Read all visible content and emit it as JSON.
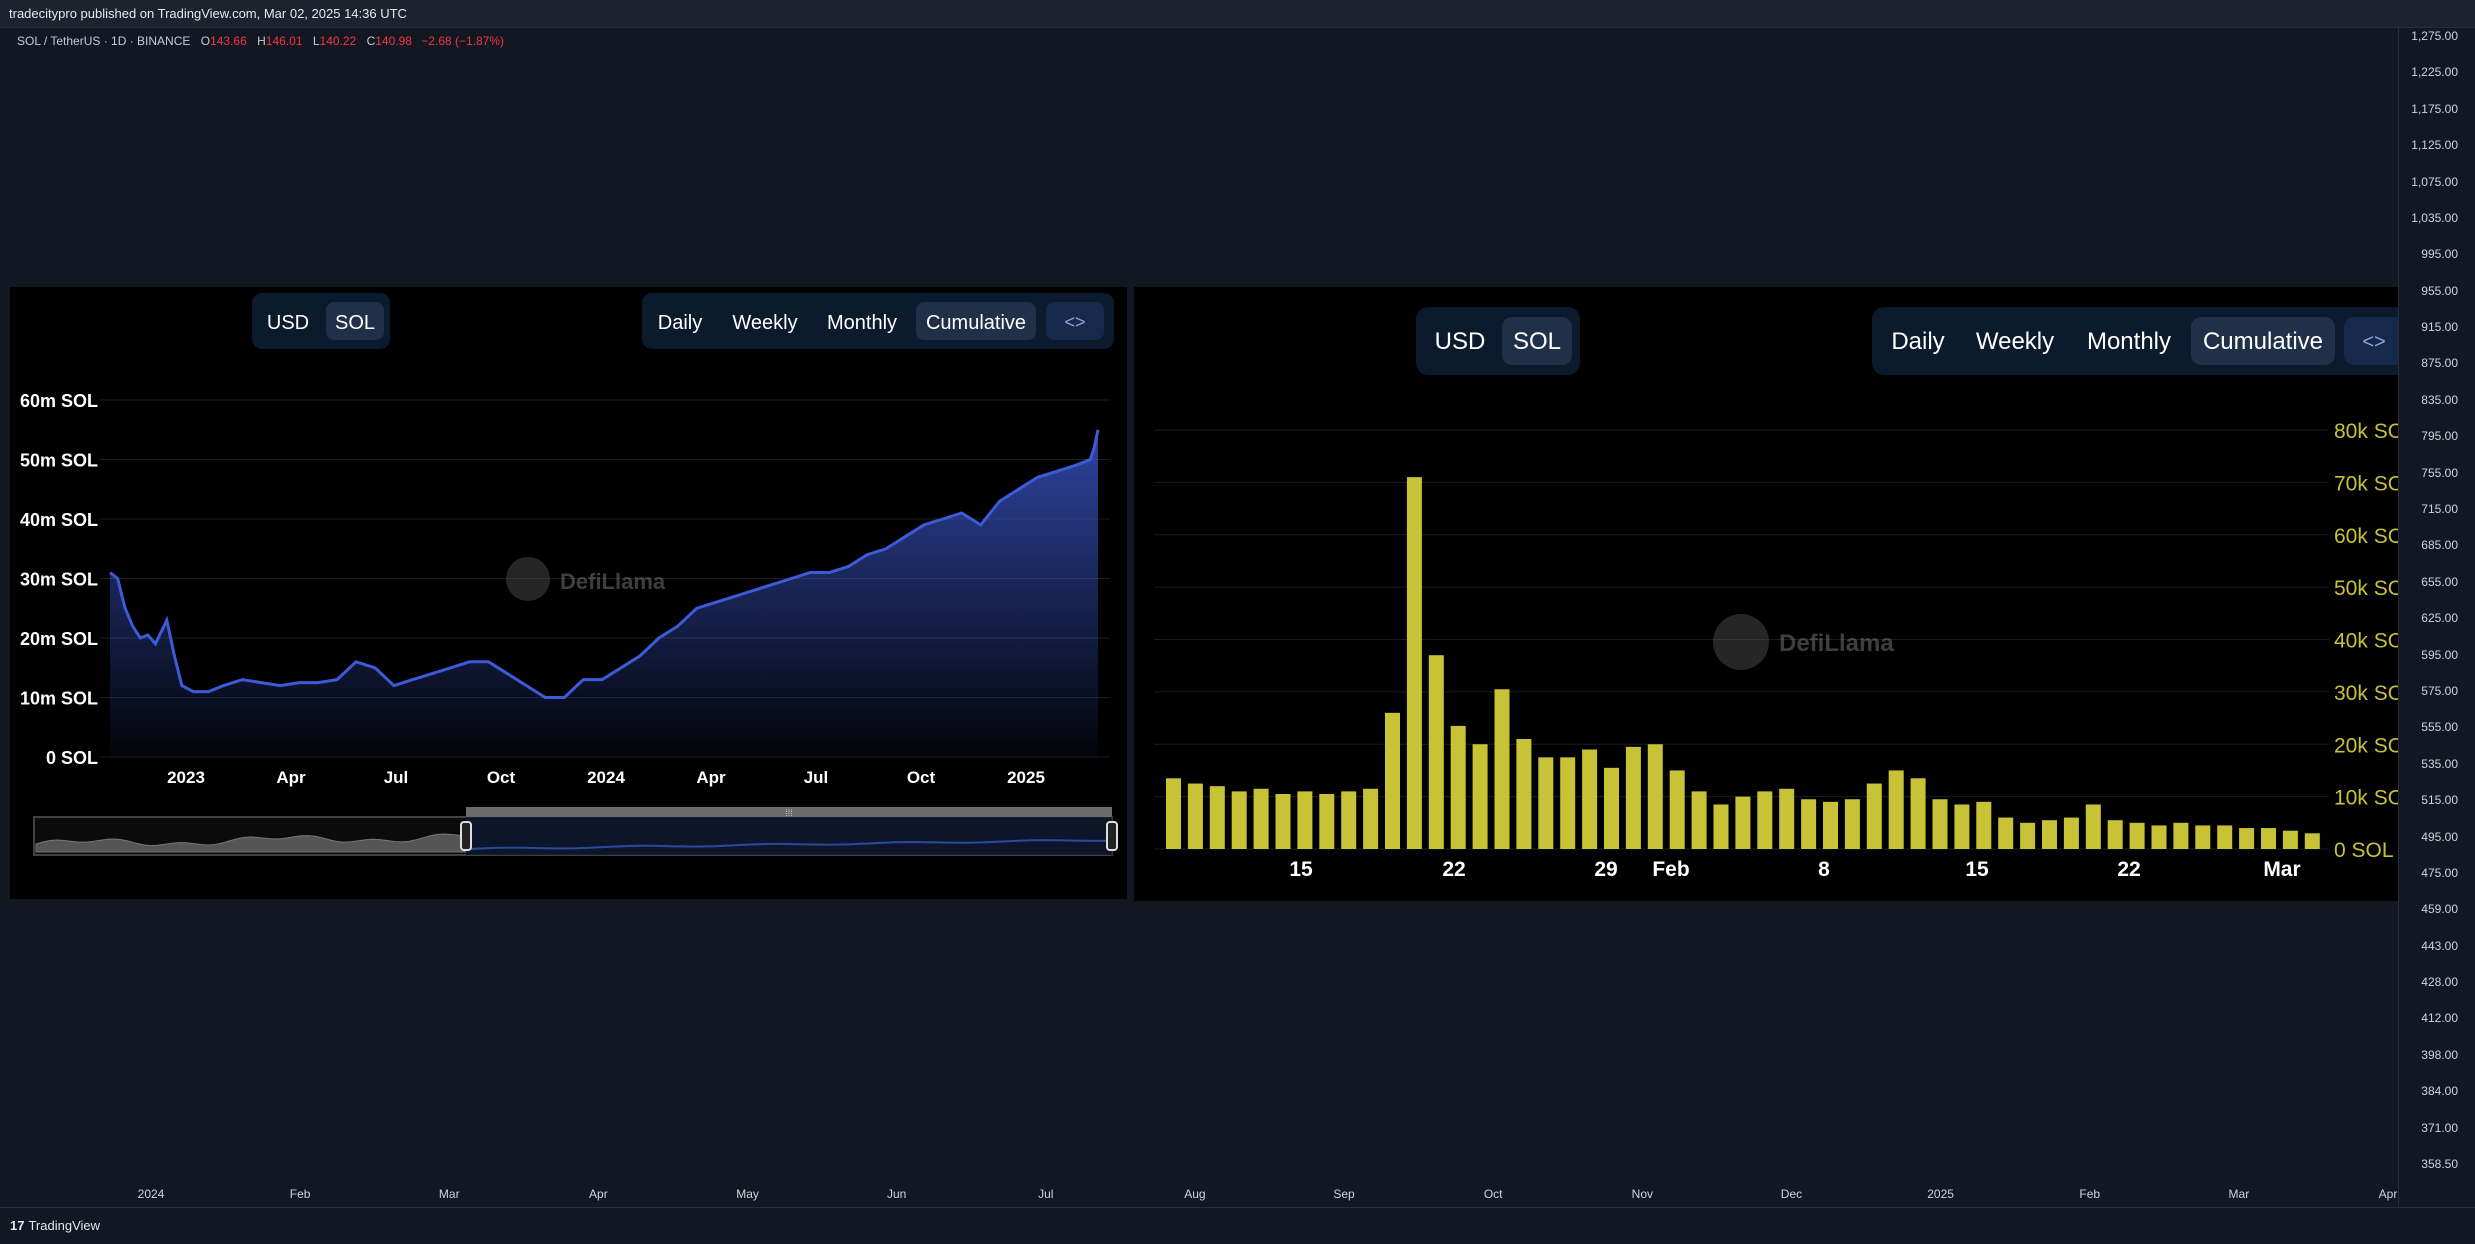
{
  "header": {
    "published": "tradecitypro published on TradingView.com, Mar 02, 2025 14:36 UTC"
  },
  "legend": {
    "symbol": "SOL / TetherUS · 1D · BINANCE",
    "open_label": "O",
    "open": "143.66",
    "high_label": "H",
    "high": "146.01",
    "low_label": "L",
    "low": "140.22",
    "close_label": "C",
    "close": "140.98",
    "change": "−2.68 (−1.87%)",
    "change_color": "#f23645"
  },
  "price_axis": [
    "1,275.00",
    "1,225.00",
    "1,175.00",
    "1,125.00",
    "1,075.00",
    "1,035.00",
    "995.00",
    "955.00",
    "915.00",
    "875.00",
    "835.00",
    "795.00",
    "755.00",
    "715.00",
    "685.00",
    "655.00",
    "625.00",
    "595.00",
    "575.00",
    "555.00",
    "535.00",
    "515.00",
    "495.00",
    "475.00",
    "459.00",
    "443.00",
    "428.00",
    "412.00",
    "398.00",
    "384.00",
    "371.00",
    "358.50"
  ],
  "time_axis": [
    "2024",
    "Feb",
    "Mar",
    "Apr",
    "May",
    "Jun",
    "Jul",
    "Aug",
    "Sep",
    "Oct",
    "Nov",
    "Dec",
    "2025",
    "Feb",
    "Mar",
    "Apr"
  ],
  "footer": {
    "brand": "TradingView",
    "brand_mark": "17"
  },
  "panels": {
    "left": {
      "currency_tabs": [
        "USD",
        "SOL"
      ],
      "active_currency": "SOL",
      "period_tabs": [
        "Daily",
        "Weekly",
        "Monthly",
        "Cumulative"
      ],
      "active_period": "Cumulative",
      "embed_icon": "<>",
      "watermark": "DefiLlama"
    },
    "right": {
      "currency_tabs": [
        "USD",
        "SOL"
      ],
      "active_currency": "SOL",
      "period_tabs": [
        "Daily",
        "Weekly",
        "Monthly",
        "Cumulative"
      ],
      "active_period": "Cumulative",
      "embed_icon": "<>",
      "watermark": "DefiLlama"
    }
  },
  "chart_data": [
    {
      "type": "area",
      "color": "#3d5bd6",
      "x_ticks": [
        "2023",
        "Apr",
        "Jul",
        "Oct",
        "2024",
        "Apr",
        "Jul",
        "Oct",
        "2025"
      ],
      "y_ticks": [
        "0 SOL",
        "10m SOL",
        "20m SOL",
        "30m SOL",
        "40m SOL",
        "50m SOL",
        "60m SOL"
      ],
      "ylim": [
        0,
        60
      ],
      "y_unit": "m SOL",
      "points": [
        [
          0,
          31
        ],
        [
          0.2,
          30
        ],
        [
          0.4,
          25
        ],
        [
          0.6,
          22
        ],
        [
          0.8,
          20
        ],
        [
          1.0,
          20.5
        ],
        [
          1.2,
          19
        ],
        [
          1.5,
          23
        ],
        [
          1.7,
          17
        ],
        [
          1.9,
          12
        ],
        [
          2.2,
          11
        ],
        [
          2.6,
          11
        ],
        [
          3.0,
          12
        ],
        [
          3.5,
          13
        ],
        [
          4.0,
          12.5
        ],
        [
          4.5,
          12
        ],
        [
          5.0,
          12.5
        ],
        [
          5.5,
          12.5
        ],
        [
          6.0,
          13
        ],
        [
          6.5,
          16
        ],
        [
          7.0,
          15
        ],
        [
          7.5,
          12
        ],
        [
          8.0,
          13
        ],
        [
          8.5,
          14
        ],
        [
          9.0,
          15
        ],
        [
          9.5,
          16
        ],
        [
          10.0,
          16
        ],
        [
          10.5,
          14
        ],
        [
          11.0,
          12
        ],
        [
          11.5,
          10
        ],
        [
          12.0,
          10
        ],
        [
          12.5,
          13
        ],
        [
          13.0,
          13
        ],
        [
          13.5,
          15
        ],
        [
          14.0,
          17
        ],
        [
          14.5,
          20
        ],
        [
          15.0,
          22
        ],
        [
          15.5,
          25
        ],
        [
          16.0,
          26
        ],
        [
          16.5,
          27
        ],
        [
          17.0,
          28
        ],
        [
          17.5,
          29
        ],
        [
          18.0,
          30
        ],
        [
          18.5,
          31
        ],
        [
          19.0,
          31
        ],
        [
          19.5,
          32
        ],
        [
          20.0,
          34
        ],
        [
          20.5,
          35
        ],
        [
          21.0,
          37
        ],
        [
          21.5,
          39
        ],
        [
          22.0,
          40
        ],
        [
          22.5,
          41
        ],
        [
          23.0,
          39
        ],
        [
          23.5,
          43
        ],
        [
          24.0,
          45
        ],
        [
          24.5,
          47
        ],
        [
          25.0,
          48
        ],
        [
          25.5,
          49
        ],
        [
          25.9,
          50
        ],
        [
          26.0,
          52
        ],
        [
          26.1,
          55
        ]
      ],
      "x_domain": [
        0,
        26.1
      ]
    },
    {
      "type": "bar",
      "color": "#c8c237",
      "x_ticks": [
        "15",
        "22",
        "29",
        "Feb",
        "8",
        "15",
        "22",
        "Mar"
      ],
      "y_ticks": [
        "0 SOL",
        "10k SOL",
        "20k SOL",
        "30k SOL",
        "40k SOL",
        "50k SOL",
        "60k SOL",
        "70k SOL",
        "80k SOL"
      ],
      "ylim": [
        0,
        80
      ],
      "y_unit": "k SOL",
      "values": [
        13.5,
        12.5,
        12,
        11,
        11.5,
        10.5,
        11,
        10.5,
        11,
        11.5,
        26,
        71,
        37,
        23.5,
        20,
        30.5,
        21,
        17.5,
        17.5,
        19,
        15.5,
        19.5,
        20,
        15,
        11,
        8.5,
        10,
        11,
        11.5,
        9.5,
        9,
        9.5,
        12.5,
        15,
        13.5,
        9.5,
        8.5,
        9,
        6,
        5,
        5.5,
        6,
        8.5,
        5.5,
        5,
        4.5,
        5,
        4.5,
        4.5,
        4,
        4,
        3.5,
        3
      ]
    }
  ]
}
